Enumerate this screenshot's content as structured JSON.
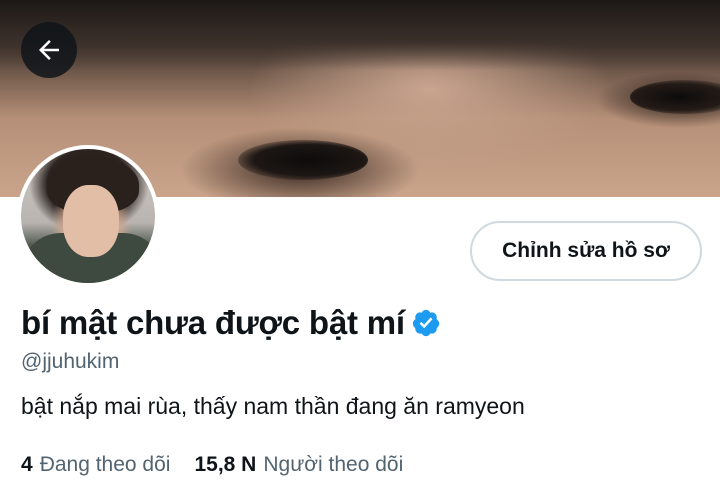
{
  "header": {
    "back_icon": "arrow-left-icon"
  },
  "profile": {
    "display_name": "bí mật chưa được bật mí",
    "verified_icon": "verified-badge-icon",
    "verified_color": "#1d9bf0",
    "handle": "@jjuhukim",
    "bio": "bật nắp mai rùa, thấy nam thần đang ăn ramyeon",
    "edit_button_label": "Chỉnh sửa hồ sơ"
  },
  "stats": {
    "following_count": "4",
    "following_label": "Đang theo dõi",
    "followers_count": "15,8 N",
    "followers_label": "Người theo dõi"
  }
}
